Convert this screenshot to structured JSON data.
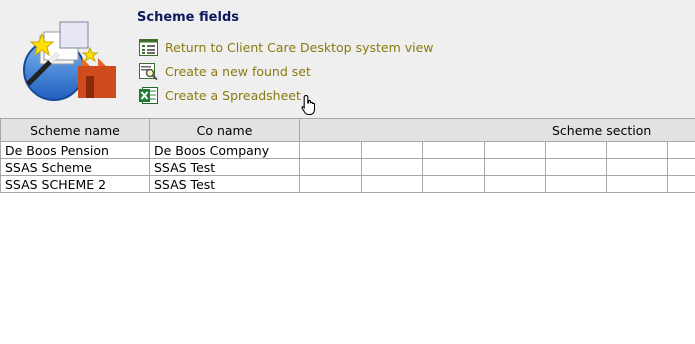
{
  "header": {
    "title": "Scheme fields",
    "links": [
      {
        "label": "Return to Client Care Desktop system view",
        "icon": "list-view-icon"
      },
      {
        "label": "Create a new found set",
        "icon": "find-set-icon"
      },
      {
        "label": "Create a Spreadsheet",
        "icon": "spreadsheet-icon"
      }
    ]
  },
  "table": {
    "columns": [
      "Scheme name",
      "Co name",
      "Scheme section"
    ],
    "rows": [
      {
        "scheme_name": "De Boos Pension",
        "co_name": "De Boos Company"
      },
      {
        "scheme_name": "SSAS Scheme",
        "co_name": "SSAS Test"
      },
      {
        "scheme_name": "SSAS SCHEME 2",
        "co_name": "SSAS Test"
      }
    ]
  },
  "colors": {
    "title": "#0e1a5e",
    "link": "#8a7a10",
    "header_bg": "#efefef",
    "grid_border": "#a8a8a8"
  }
}
